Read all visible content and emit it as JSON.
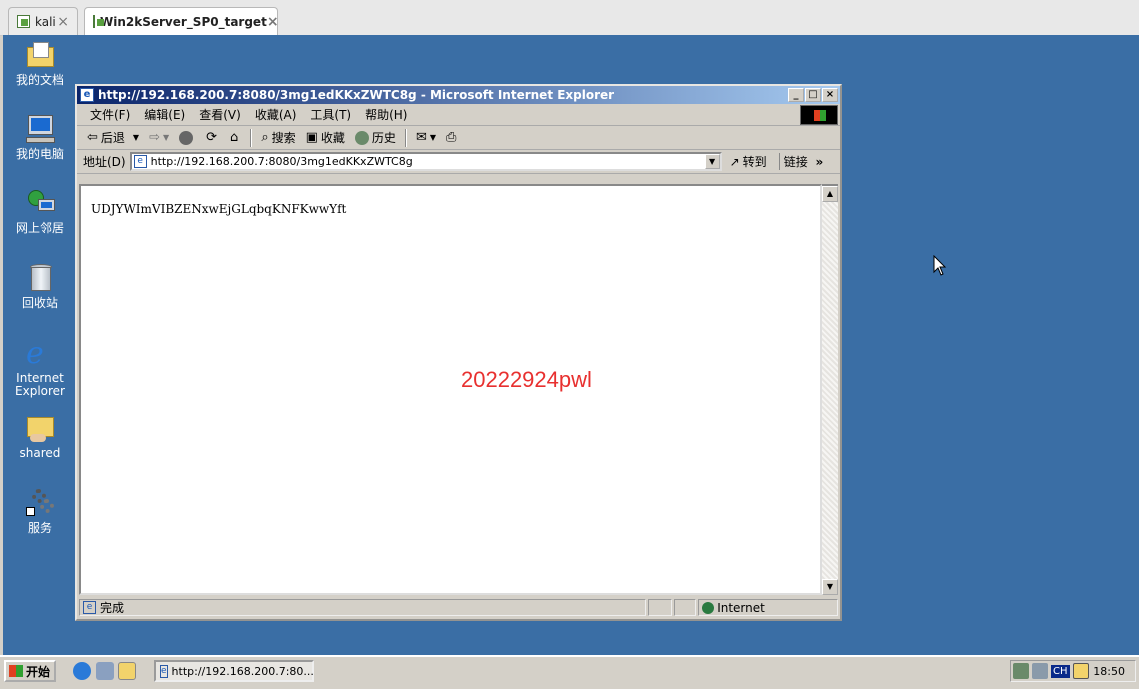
{
  "vm_tabs": [
    {
      "label": "kali",
      "close": "×"
    },
    {
      "label": "Win2kServer_SP0_target",
      "close": "×"
    }
  ],
  "desktop_icons": [
    {
      "label": "我的文档",
      "icon": "folder-documents-icon"
    },
    {
      "label": "我的电脑",
      "icon": "my-computer-icon"
    },
    {
      "label": "网上邻居",
      "icon": "network-places-icon"
    },
    {
      "label": "回收站",
      "icon": "recycle-bin-icon"
    },
    {
      "label": "Internet Explorer",
      "icon": "internet-explorer-icon"
    },
    {
      "label": "shared",
      "icon": "shared-folder-icon"
    },
    {
      "label": "服务",
      "icon": "services-icon"
    }
  ],
  "ie": {
    "title": "http://192.168.200.7:8080/3mg1edKKxZWTC8g - Microsoft Internet Explorer",
    "title_buttons": {
      "minimize": "_",
      "maximize": "□",
      "close": "×"
    },
    "menu": [
      "文件(F)",
      "编辑(E)",
      "查看(V)",
      "收藏(A)",
      "工具(T)",
      "帮助(H)"
    ],
    "toolbar": {
      "back": "后退",
      "search": "搜索",
      "favorites": "收藏",
      "history": "历史"
    },
    "address_label": "地址(D)",
    "address_value": "http://192.168.200.7:8080/3mg1edKKxZWTC8g",
    "go_label": "转到",
    "links_label": "链接",
    "page_text": "UDJYWImVIBZENxwEjGLqbqKNFKwwYft",
    "watermark": "20222924pwl",
    "status_text": "完成",
    "status_zone": "Internet"
  },
  "taskbar": {
    "start_label": "开始",
    "task_button": "http://192.168.200.7:80...",
    "tray_lang": "CH",
    "clock": "18:50"
  },
  "colors": {
    "desktop": "#3a6ea5",
    "title_active": "#0a246a",
    "watermark": "#e8302f"
  }
}
